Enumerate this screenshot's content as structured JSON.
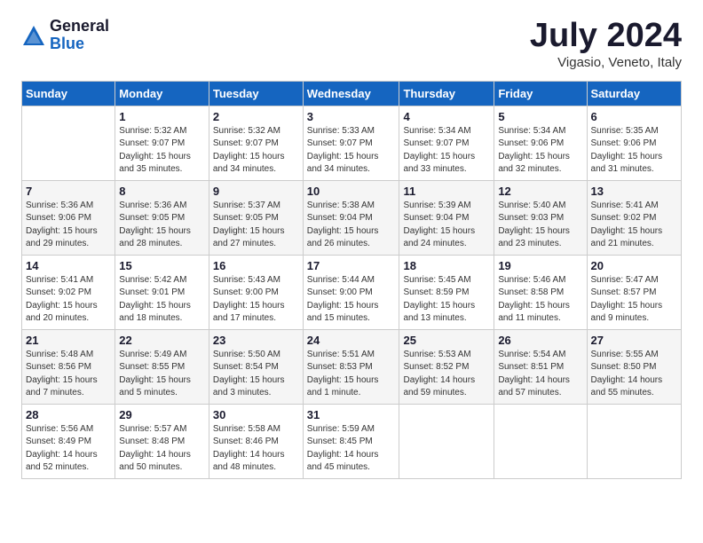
{
  "header": {
    "logo_general": "General",
    "logo_blue": "Blue",
    "month_title": "July 2024",
    "location": "Vigasio, Veneto, Italy"
  },
  "calendar": {
    "days_of_week": [
      "Sunday",
      "Monday",
      "Tuesday",
      "Wednesday",
      "Thursday",
      "Friday",
      "Saturday"
    ],
    "weeks": [
      [
        {
          "day": "",
          "info": ""
        },
        {
          "day": "1",
          "info": "Sunrise: 5:32 AM\nSunset: 9:07 PM\nDaylight: 15 hours\nand 35 minutes."
        },
        {
          "day": "2",
          "info": "Sunrise: 5:32 AM\nSunset: 9:07 PM\nDaylight: 15 hours\nand 34 minutes."
        },
        {
          "day": "3",
          "info": "Sunrise: 5:33 AM\nSunset: 9:07 PM\nDaylight: 15 hours\nand 34 minutes."
        },
        {
          "day": "4",
          "info": "Sunrise: 5:34 AM\nSunset: 9:07 PM\nDaylight: 15 hours\nand 33 minutes."
        },
        {
          "day": "5",
          "info": "Sunrise: 5:34 AM\nSunset: 9:06 PM\nDaylight: 15 hours\nand 32 minutes."
        },
        {
          "day": "6",
          "info": "Sunrise: 5:35 AM\nSunset: 9:06 PM\nDaylight: 15 hours\nand 31 minutes."
        }
      ],
      [
        {
          "day": "7",
          "info": "Sunrise: 5:36 AM\nSunset: 9:06 PM\nDaylight: 15 hours\nand 29 minutes."
        },
        {
          "day": "8",
          "info": "Sunrise: 5:36 AM\nSunset: 9:05 PM\nDaylight: 15 hours\nand 28 minutes."
        },
        {
          "day": "9",
          "info": "Sunrise: 5:37 AM\nSunset: 9:05 PM\nDaylight: 15 hours\nand 27 minutes."
        },
        {
          "day": "10",
          "info": "Sunrise: 5:38 AM\nSunset: 9:04 PM\nDaylight: 15 hours\nand 26 minutes."
        },
        {
          "day": "11",
          "info": "Sunrise: 5:39 AM\nSunset: 9:04 PM\nDaylight: 15 hours\nand 24 minutes."
        },
        {
          "day": "12",
          "info": "Sunrise: 5:40 AM\nSunset: 9:03 PM\nDaylight: 15 hours\nand 23 minutes."
        },
        {
          "day": "13",
          "info": "Sunrise: 5:41 AM\nSunset: 9:02 PM\nDaylight: 15 hours\nand 21 minutes."
        }
      ],
      [
        {
          "day": "14",
          "info": "Sunrise: 5:41 AM\nSunset: 9:02 PM\nDaylight: 15 hours\nand 20 minutes."
        },
        {
          "day": "15",
          "info": "Sunrise: 5:42 AM\nSunset: 9:01 PM\nDaylight: 15 hours\nand 18 minutes."
        },
        {
          "day": "16",
          "info": "Sunrise: 5:43 AM\nSunset: 9:00 PM\nDaylight: 15 hours\nand 17 minutes."
        },
        {
          "day": "17",
          "info": "Sunrise: 5:44 AM\nSunset: 9:00 PM\nDaylight: 15 hours\nand 15 minutes."
        },
        {
          "day": "18",
          "info": "Sunrise: 5:45 AM\nSunset: 8:59 PM\nDaylight: 15 hours\nand 13 minutes."
        },
        {
          "day": "19",
          "info": "Sunrise: 5:46 AM\nSunset: 8:58 PM\nDaylight: 15 hours\nand 11 minutes."
        },
        {
          "day": "20",
          "info": "Sunrise: 5:47 AM\nSunset: 8:57 PM\nDaylight: 15 hours\nand 9 minutes."
        }
      ],
      [
        {
          "day": "21",
          "info": "Sunrise: 5:48 AM\nSunset: 8:56 PM\nDaylight: 15 hours\nand 7 minutes."
        },
        {
          "day": "22",
          "info": "Sunrise: 5:49 AM\nSunset: 8:55 PM\nDaylight: 15 hours\nand 5 minutes."
        },
        {
          "day": "23",
          "info": "Sunrise: 5:50 AM\nSunset: 8:54 PM\nDaylight: 15 hours\nand 3 minutes."
        },
        {
          "day": "24",
          "info": "Sunrise: 5:51 AM\nSunset: 8:53 PM\nDaylight: 15 hours\nand 1 minute."
        },
        {
          "day": "25",
          "info": "Sunrise: 5:53 AM\nSunset: 8:52 PM\nDaylight: 14 hours\nand 59 minutes."
        },
        {
          "day": "26",
          "info": "Sunrise: 5:54 AM\nSunset: 8:51 PM\nDaylight: 14 hours\nand 57 minutes."
        },
        {
          "day": "27",
          "info": "Sunrise: 5:55 AM\nSunset: 8:50 PM\nDaylight: 14 hours\nand 55 minutes."
        }
      ],
      [
        {
          "day": "28",
          "info": "Sunrise: 5:56 AM\nSunset: 8:49 PM\nDaylight: 14 hours\nand 52 minutes."
        },
        {
          "day": "29",
          "info": "Sunrise: 5:57 AM\nSunset: 8:48 PM\nDaylight: 14 hours\nand 50 minutes."
        },
        {
          "day": "30",
          "info": "Sunrise: 5:58 AM\nSunset: 8:46 PM\nDaylight: 14 hours\nand 48 minutes."
        },
        {
          "day": "31",
          "info": "Sunrise: 5:59 AM\nSunset: 8:45 PM\nDaylight: 14 hours\nand 45 minutes."
        },
        {
          "day": "",
          "info": ""
        },
        {
          "day": "",
          "info": ""
        },
        {
          "day": "",
          "info": ""
        }
      ]
    ]
  }
}
